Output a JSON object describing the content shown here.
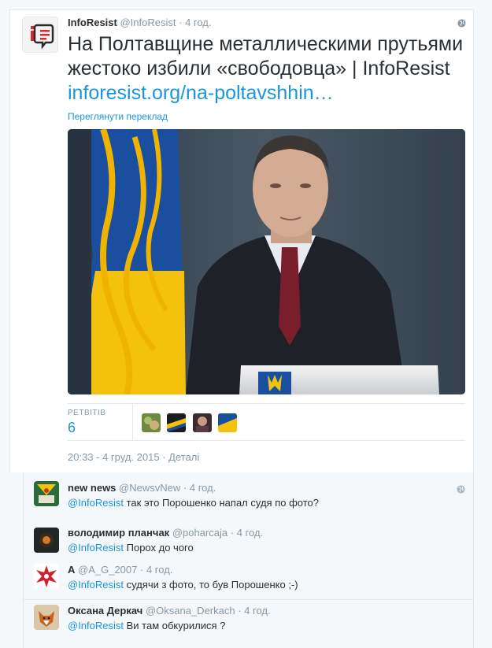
{
  "tweet": {
    "author_name": "InfoResist",
    "author_handle": "@InfoResist",
    "dot": "·",
    "time": "4 год.",
    "text": "На Полтавщине металлическими прутьями жестоко избили «свободовца» | InfoResist",
    "link": "inforesist.org/na-poltavshhin…",
    "translate_label": "Переглянути переклад",
    "media_icon": "portrait-with-flag-photo",
    "retweets_label": "РЕТВІТІВ",
    "retweets_count": "6",
    "timestamp": "20:33 - 4 груд. 2015",
    "separator": "·",
    "details_label": "Деталі",
    "globe_icon": "globe-icon"
  },
  "replies": [
    {
      "name": "new news",
      "handle": "@NewsvNew",
      "time": "4 год.",
      "mention": "@InfoResist",
      "text": "так это Порошенко напал судя по фото?",
      "has_globe": true
    },
    {
      "name": "володимир планчак",
      "handle": "@poharcaja",
      "time": "4 год.",
      "mention": "@InfoResist",
      "text": "Порох до чого",
      "has_globe": false
    },
    {
      "name": "A",
      "handle": "@A_G_2007",
      "time": "4 год.",
      "mention": "@InfoResist",
      "text": "судячи з фото, то був Порошенко ;-)",
      "has_globe": false
    },
    {
      "name": "Оксана Деркач",
      "handle": "@Oksana_Derkach",
      "time": "4 год.",
      "mention": "@InfoResist",
      "text": "Ви там обкурилися ?",
      "has_globe": false
    }
  ],
  "colors": {
    "link": "#1b95e0",
    "muted": "#8899a6",
    "text": "#292f33",
    "border": "#e1e8ed"
  }
}
